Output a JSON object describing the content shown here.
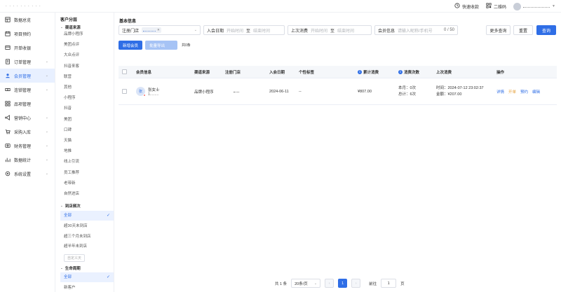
{
  "topbar": {
    "logo": ". . . . . . . . . .",
    "quick_cashier": "快速收款",
    "qrcode": "二维码"
  },
  "sidebar": {
    "items": [
      {
        "label": "数据总览",
        "icon": "dashboard-icon",
        "chevron": false
      },
      {
        "label": "项目预约",
        "icon": "calendar-icon",
        "chevron": false
      },
      {
        "label": "开单收银",
        "icon": "cashier-icon",
        "chevron": false
      },
      {
        "label": "订单管理",
        "icon": "order-icon",
        "chevron": true
      },
      {
        "label": "会员管理",
        "icon": "member-icon",
        "chevron": true,
        "active": true
      },
      {
        "label": "连锁管理",
        "icon": "chain-icon",
        "chevron": true
      },
      {
        "label": "品项管理",
        "icon": "item-icon",
        "chevron": false
      },
      {
        "label": "营销中心",
        "icon": "marketing-icon",
        "chevron": true
      },
      {
        "label": "采购入库",
        "icon": "purchase-icon",
        "chevron": true
      },
      {
        "label": "财务管理",
        "icon": "finance-icon",
        "chevron": true
      },
      {
        "label": "数据统计",
        "icon": "stats-icon",
        "chevron": true
      },
      {
        "label": "系统设置",
        "icon": "settings-icon",
        "chevron": true
      }
    ]
  },
  "filter": {
    "title": "客户分层",
    "channel_group": "渠道来源",
    "channels": [
      "品牌小程序",
      "美团点评",
      "大众点评",
      "抖音来客",
      "联营",
      "其他",
      "小程序",
      "抖音",
      "美团",
      "口碑",
      "天猫",
      "地推",
      "线上引流",
      "员工推荐",
      "老带新",
      "自然进店"
    ],
    "visit_group": "到店频次",
    "visits": [
      "全部",
      "超30天未到店",
      "超三个月未到店",
      "超半年未到店"
    ],
    "visit_custom": "自定义天",
    "life_group": "生命周期",
    "life_items": [
      "全部",
      "新客户"
    ]
  },
  "main": {
    "section_title": "基本信息",
    "store_label": "注册门店",
    "join_label": "入会日期",
    "join_start": "开始时间",
    "join_to": "至",
    "join_end": "结束时间",
    "last_label": "上次消费",
    "last_start": "开始时间",
    "last_to": "至",
    "last_end": "结束时间",
    "member_label": "会员信息",
    "member_placeholder": "请输入昵称/手机号",
    "member_count": "0 / 50",
    "more_btn": "更多查询",
    "reset_btn": "重置",
    "query_btn": "查询",
    "add_btn": "新增会员",
    "batch_btn": "批量导出",
    "count_text": "共0条"
  },
  "table": {
    "headers": [
      "会员信息",
      "渠道来源",
      "注册门店",
      "入会日期",
      "个性标签",
      "累计消费",
      "消费次数",
      "上次消费",
      "操作"
    ],
    "row": {
      "avatar_text": "张",
      "name": "张女士",
      "phone": "1.........",
      "channel": "品牌小程序",
      "store": "",
      "join_date": "2024-06-11",
      "tags": "--",
      "total_spend": "¥807.00",
      "count_month": "本月：0次",
      "count_total": "总计：6次",
      "last_time": "时间：2024-07-12 23:02:37",
      "last_amount": "金额：¥207.00",
      "ops": [
        "详情",
        "开单",
        "预约",
        "编辑"
      ]
    }
  },
  "pager": {
    "total": "共 1 条",
    "per_page": "20条/页",
    "current": "1",
    "goto_label": "前往",
    "goto_value": "1",
    "page_suffix": "页"
  }
}
